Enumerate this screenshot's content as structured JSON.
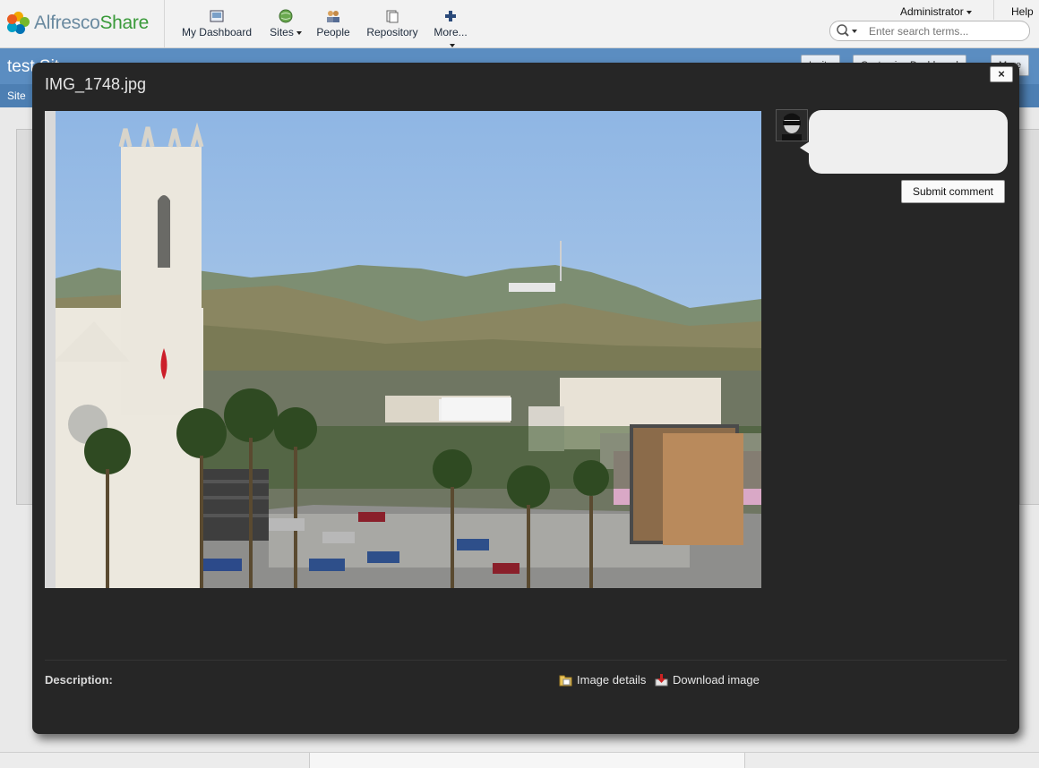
{
  "header": {
    "logo": {
      "prefix": "Alfresco",
      "suffix": "Share"
    },
    "nav": [
      {
        "label": "My Dashboard",
        "icon": "dashboard-icon"
      },
      {
        "label": "Sites",
        "icon": "sites-globe-icon",
        "dropdown": true
      },
      {
        "label": "People",
        "icon": "people-icon"
      },
      {
        "label": "Repository",
        "icon": "repository-icon"
      },
      {
        "label": "More...",
        "icon": "plus-icon",
        "dropdown": true
      }
    ],
    "user_menu": "Administrator",
    "help": "Help",
    "search_placeholder": "Enter search terms..."
  },
  "site": {
    "title_partial": "test Sit",
    "subnav_partial": "Site",
    "buttons_partial": [
      "Invite",
      "Customize Dashboard",
      "More"
    ]
  },
  "modal": {
    "title": "IMG_1748.jpg",
    "close_label": "×",
    "description_label": "Description:",
    "links": {
      "image_details": "Image details",
      "download_image": "Download image"
    },
    "comment_placeholder": "",
    "submit_label": "Submit comment"
  },
  "colors": {
    "site_banner": "#5b8dc1",
    "modal_bg": "#262626",
    "sky": "#9cbfe8"
  }
}
